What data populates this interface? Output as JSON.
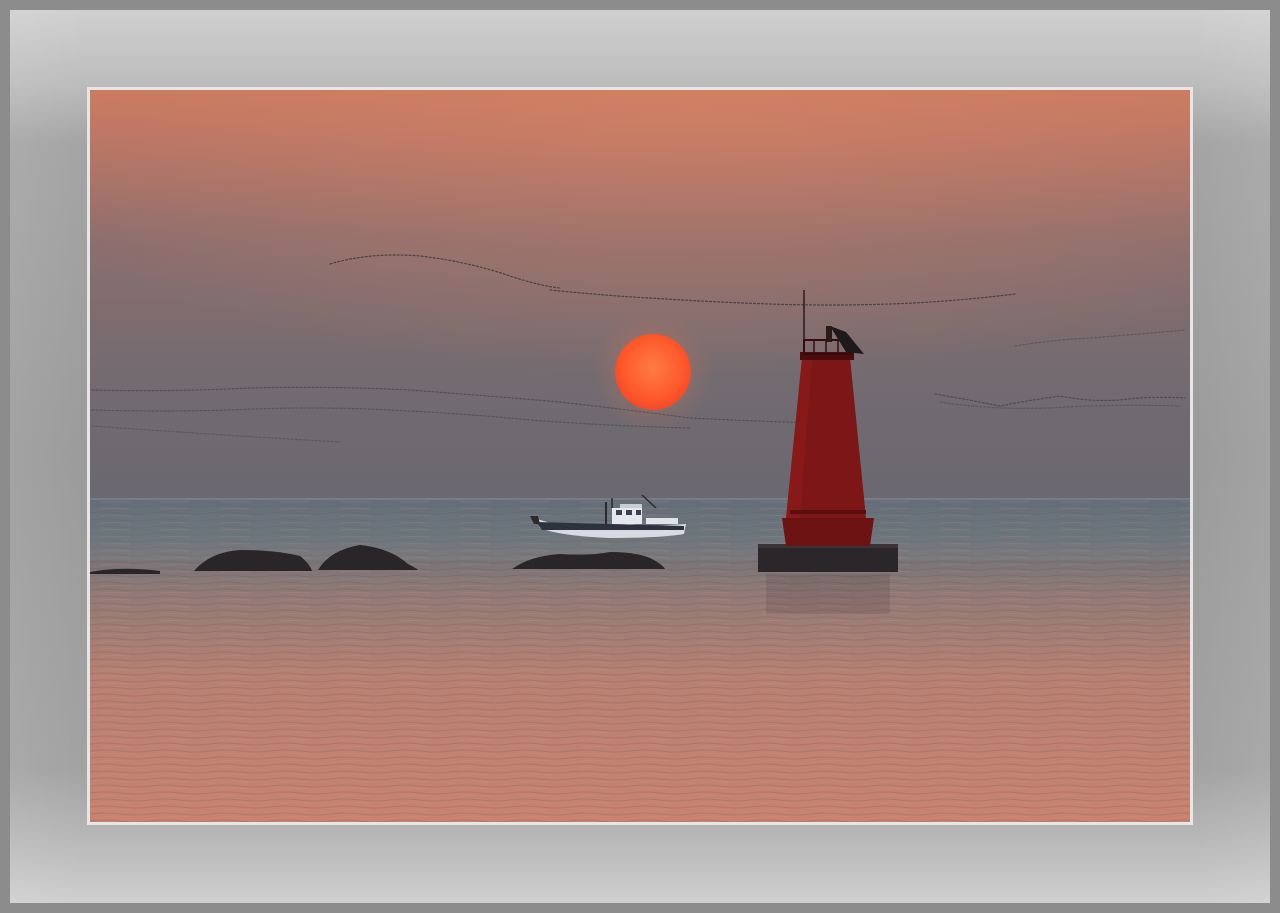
{
  "scene": {
    "subject": "sunset-over-sea",
    "colors": {
      "sky_top": "#cf7f64",
      "sky_mid": "#8a6e6d",
      "sky_horizon": "#6d6a72",
      "sea_near": "#c88475",
      "sea_far": "#5d6672",
      "sun": "#ff5a2e",
      "lighthouse": "#7a1414",
      "mat": "#a0a0a0"
    }
  }
}
